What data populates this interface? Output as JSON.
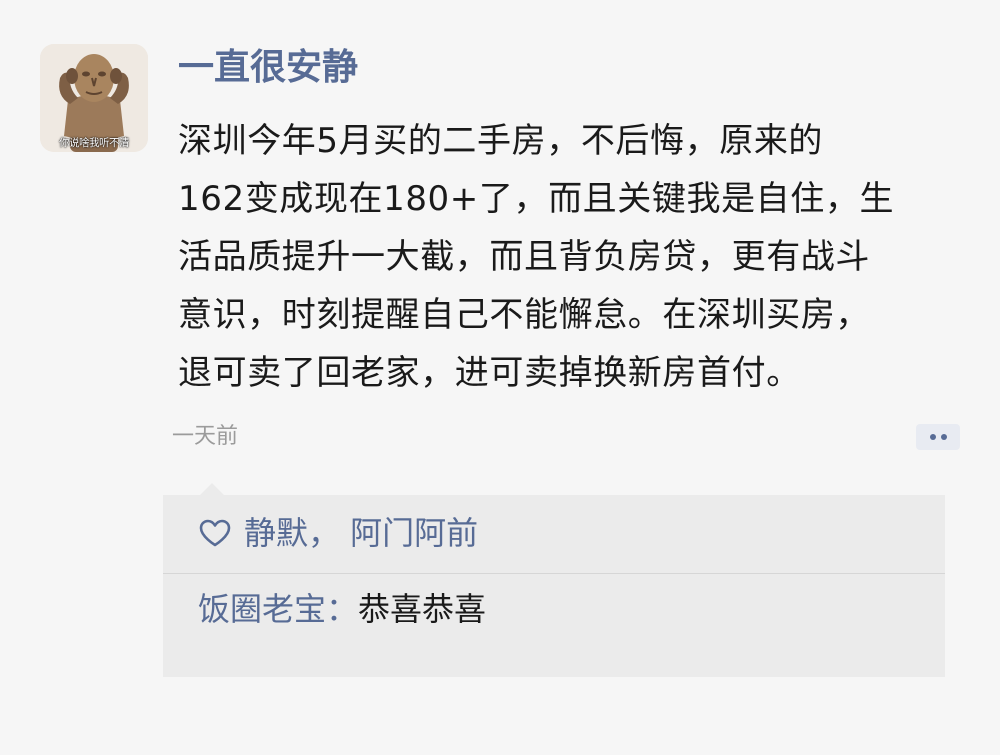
{
  "post": {
    "avatar_caption": "你说啥我听不清",
    "username": "一直很安静",
    "content_lines": [
      "深圳今年5月买的二手房，不后悔，原来的",
      "162变成现在180+了，而且关键我是自住，生",
      "活品质提升一大截，而且背负房贷，更有战斗",
      "意识，时刻提醒自己不能懈怠。在深圳买房，",
      "退可卖了回老家，进可卖掉换新房首付。"
    ],
    "time": "一天前"
  },
  "likes": {
    "icon": "heart-outline-icon",
    "names": "静默， 阿门阿前"
  },
  "comments": [
    {
      "author": "饭圈老宝",
      "separator": "：",
      "text": "恭喜恭喜"
    }
  ],
  "colors": {
    "link_blue": "#576b95",
    "text": "#1a1a1a",
    "muted": "#9b9b9b",
    "background": "#f6f6f6",
    "panel": "#ebebeb"
  }
}
